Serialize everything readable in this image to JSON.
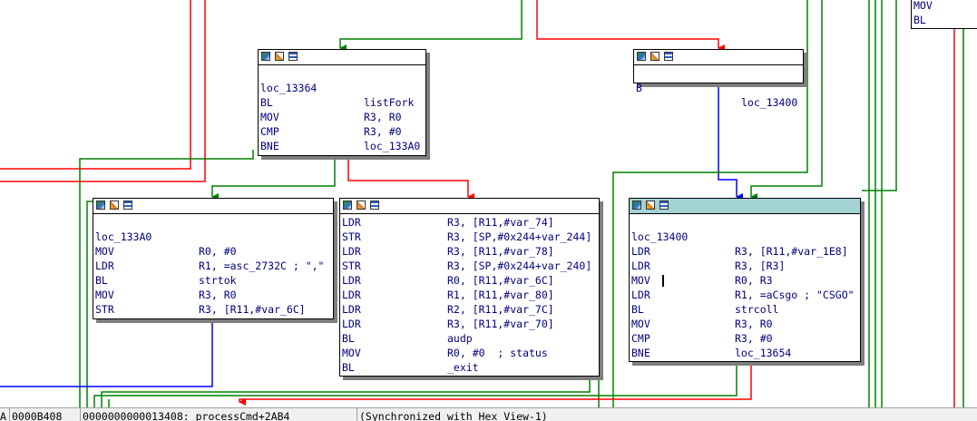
{
  "colors": {
    "true_edge": "#008000",
    "false_edge": "#ff0000",
    "jump_edge": "#0000ff",
    "header_highlight": "#a3d3d3",
    "text": "#000080"
  },
  "node_icons": [
    "graph-overview-icon",
    "edit-icon",
    "listing-icon"
  ],
  "corner_node": {
    "lines": [
      {
        "mn": "MOV",
        "op": ""
      },
      {
        "mn": "BL",
        "op": ""
      }
    ]
  },
  "node_b": {
    "lines": [
      {
        "mn": "B",
        "op": "loc_13400"
      }
    ]
  },
  "node_13364": {
    "label": "loc_13364",
    "lines": [
      {
        "mn": "BL",
        "op": "listFork"
      },
      {
        "mn": "MOV",
        "op": "R3, R0"
      },
      {
        "mn": "CMP",
        "op": "R3, #0"
      },
      {
        "mn": "BNE",
        "op": "loc_133A0"
      }
    ]
  },
  "node_133a0": {
    "label": "loc_133A0",
    "lines": [
      {
        "mn": "MOV",
        "op": "R0, #0"
      },
      {
        "mn": "LDR",
        "op": "R1, =asc_2732C ; \",\""
      },
      {
        "mn": "BL",
        "op": "strtok"
      },
      {
        "mn": "MOV",
        "op": "R3, R0"
      },
      {
        "mn": "STR",
        "op": "R3, [R11,#var_6C]"
      }
    ]
  },
  "node_audp": {
    "lines": [
      {
        "mn": "LDR",
        "op": "R3, [R11,#var_74]"
      },
      {
        "mn": "STR",
        "op": "R3, [SP,#0x244+var_244]"
      },
      {
        "mn": "LDR",
        "op": "R3, [R11,#var_78]"
      },
      {
        "mn": "STR",
        "op": "R3, [SP,#0x244+var_240]"
      },
      {
        "mn": "LDR",
        "op": "R0, [R11,#var_6C]"
      },
      {
        "mn": "LDR",
        "op": "R1, [R11,#var_80]"
      },
      {
        "mn": "LDR",
        "op": "R2, [R11,#var_7C]"
      },
      {
        "mn": "LDR",
        "op": "R3, [R11,#var_70]"
      },
      {
        "mn": "BL",
        "op": "audp"
      },
      {
        "mn": "MOV",
        "op": "R0, #0  ; status"
      },
      {
        "mn": "BL",
        "op": "_exit"
      }
    ]
  },
  "node_13400": {
    "label": "loc_13400",
    "lines": [
      {
        "mn": "LDR",
        "op": "R3, [R11,#var_1E8]"
      },
      {
        "mn": "LDR",
        "op": "R3, [R3]"
      },
      {
        "mn": "MOV",
        "op": "R0, R3"
      },
      {
        "mn": "LDR",
        "op": "R1, =aCsgo ; \"CSGO\""
      },
      {
        "mn": "BL",
        "op": "strcoll"
      },
      {
        "mn": "MOV",
        "op": "R3, R0"
      },
      {
        "mn": "CMP",
        "op": "R3, #0"
      },
      {
        "mn": "BNE",
        "op": "loc_13654"
      }
    ]
  },
  "statusbar": {
    "prefix": "A",
    "offset": "0000B408",
    "address_text": "0000000000013408: processCmd+2AB4",
    "sync_text": "(Synchronized with Hex View-1)"
  }
}
